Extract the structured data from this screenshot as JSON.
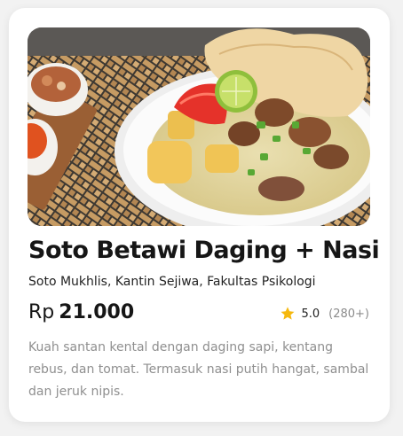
{
  "menu_card": {
    "image_icon": "soto-betawi-bowl-photo",
    "title": "Soto Betawi Daging + Nasi",
    "location": "Soto Mukhlis, Kantin Sejiwa, Fakultas Psikologi",
    "price_currency": "Rp",
    "price_value": "21.000",
    "rating_icon": "star-icon",
    "rating_score": "5.0",
    "rating_count": "(280+)",
    "description": "Kuah santan kental dengan daging sapi, kentang rebus, dan tomat. Termasuk nasi putih hangat, sambal dan jeruk nipis.",
    "colors": {
      "star": "#f5b80e",
      "title": "#161616",
      "muted": "#8f8f8f",
      "card": "#ffffff"
    }
  }
}
